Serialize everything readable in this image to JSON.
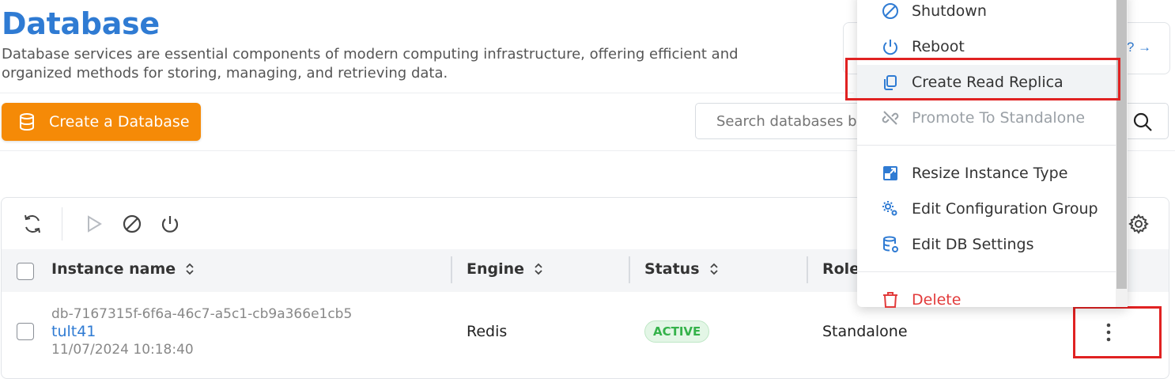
{
  "header": {
    "title": "Database",
    "description": "Database services are essential components of modern computing infrastructure, offering efficient and organized methods for storing, managing, and retrieving data.",
    "help_link": "? →"
  },
  "actions": {
    "create_label": "Create a Database",
    "search_placeholder": "Search databases b"
  },
  "table": {
    "columns": [
      {
        "label": "Instance name"
      },
      {
        "label": "Engine"
      },
      {
        "label": "Status"
      },
      {
        "label": "Role"
      }
    ],
    "rows": [
      {
        "id": "db-7167315f-6f6a-46c7-a5c1-cb9a366e1cb5",
        "name": "tult41",
        "date": "11/07/2024 10:18:40",
        "engine": "Redis",
        "status": "ACTIVE",
        "role": "Standalone"
      }
    ]
  },
  "context_menu": {
    "items": [
      {
        "label": "Shutdown",
        "icon": "ban-icon",
        "state": "enabled"
      },
      {
        "label": "Reboot",
        "icon": "power-icon",
        "state": "enabled"
      },
      {
        "label": "Create Read Replica",
        "icon": "copy-icon",
        "state": "highlighted"
      },
      {
        "label": "Promote To Standalone",
        "icon": "unlink-icon",
        "state": "disabled"
      },
      {
        "label": "Resize Instance Type",
        "icon": "resize-icon",
        "state": "enabled"
      },
      {
        "label": "Edit Configuration Group",
        "icon": "gears-icon",
        "state": "enabled"
      },
      {
        "label": "Edit DB Settings",
        "icon": "database-settings-icon",
        "state": "enabled"
      },
      {
        "label": "Delete",
        "icon": "trash-icon",
        "state": "danger"
      }
    ]
  },
  "colors": {
    "brand_blue": "#2f7bd3",
    "primary_orange": "#f58a07",
    "active_green": "#34b24a",
    "danger_red": "#e23b3b",
    "annotation_red": "#e02222"
  }
}
